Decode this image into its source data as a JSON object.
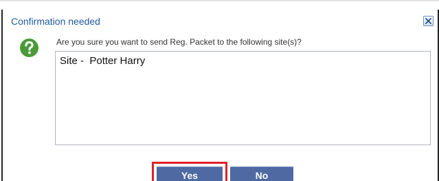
{
  "dialog": {
    "title": "Confirmation needed",
    "close_icon": "close-icon",
    "question_icon": "question-icon",
    "message": "Are you sure you want to send Reg. Packet to the following site(s)?",
    "site_list_text": "Site -  Potter Harry",
    "buttons": {
      "yes_label": "Yes",
      "no_label": "No"
    }
  },
  "colors": {
    "title": "#1f5a9c",
    "button_bg": "#4f6aa3",
    "highlight": "#e0202a",
    "question_icon": "#4a9a3a"
  }
}
